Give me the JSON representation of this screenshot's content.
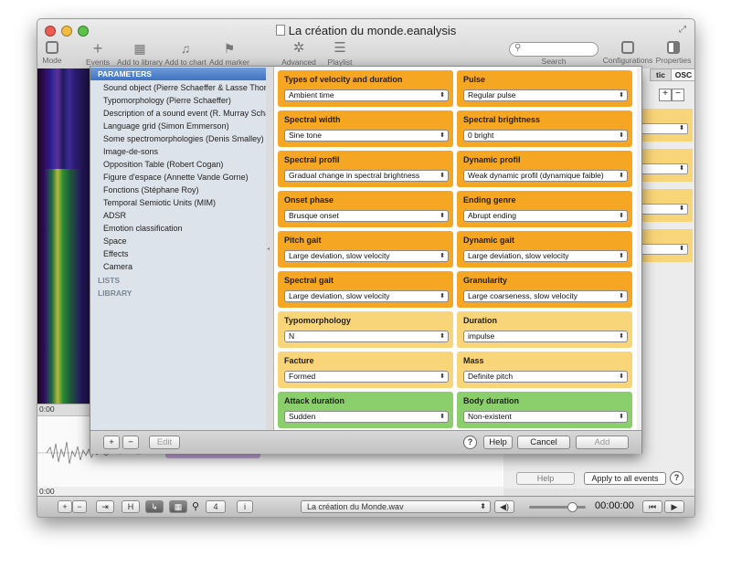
{
  "window": {
    "title": "La création du monde.eanalysis"
  },
  "toolbar": {
    "mode": "Mode",
    "events": "Events",
    "add_to_library": "Add to library",
    "add_to_chart": "Add to chart",
    "add_marker": "Add marker",
    "advanced_tools": "Advanced tools",
    "playlist": "Playlist",
    "search_label": "Search",
    "configurations": "Configurations",
    "properties": "Properties"
  },
  "right_panel": {
    "tab_partial": "tic",
    "tab_osc": "OSC",
    "help_button": "Help",
    "apply_all_button": "Apply to all events",
    "help_icon": "?"
  },
  "timeline": {
    "time_start_top": "0:00",
    "time_start_bottom": "0:00"
  },
  "bottom_bar": {
    "plus": "+",
    "minus": "−",
    "zoom_value": "4",
    "info": "i",
    "audio_file": "La création du Monde.wav",
    "time": "00:00:00"
  },
  "library": {
    "parameters_header": "PARAMETERS",
    "items": [
      "Sound object (Pierre Schaeffer & Lasse Thoresen)",
      "Typomorphology (Pierre Schaeffer)",
      "Description of a sound event (R. Murray Schafer)",
      "Language grid (Simon Emmerson)",
      "Some spectromorphologies (Denis Smalley)",
      "Image-de-sons",
      "Opposition Table (Robert Cogan)",
      "Figure d'espace (Annette Vande Gorne)",
      "Fonctions (Stéphane Roy)",
      "Temporal Semiotic Units (MIM)",
      "ADSR",
      "Emotion classification",
      "Space",
      "Effects",
      "Camera"
    ],
    "lists_header": "LISTS",
    "library_header": "LIBRARY"
  },
  "fields": [
    {
      "label": "Types of velocity and duration",
      "value": "Ambient time",
      "color": "#f5a623"
    },
    {
      "label": "Pulse",
      "value": "Regular pulse",
      "color": "#f5a623"
    },
    {
      "label": "Spectral width",
      "value": "Sine tone",
      "color": "#f5a623"
    },
    {
      "label": "Spectral brightness",
      "value": "0 bright",
      "color": "#f5a623"
    },
    {
      "label": "Spectral profil",
      "value": "Gradual change in spectral brightness",
      "color": "#f5a623"
    },
    {
      "label": "Dynamic profil",
      "value": "Weak dynamic profil (dynamique faible)",
      "color": "#f5a623"
    },
    {
      "label": "Onset phase",
      "value": "Brusque onset",
      "color": "#f5a623"
    },
    {
      "label": "Ending genre",
      "value": "Abrupt ending",
      "color": "#f5a623"
    },
    {
      "label": "Pitch gait",
      "value": "Large deviation, slow velocity",
      "color": "#f5a623"
    },
    {
      "label": "Dynamic gait",
      "value": "Large deviation, slow velocity",
      "color": "#f5a623"
    },
    {
      "label": "Spectral gait",
      "value": "Large deviation, slow velocity",
      "color": "#f5a623"
    },
    {
      "label": "Granularity",
      "value": "Large coarseness, slow velocity",
      "color": "#f5a623"
    },
    {
      "label": "Typomorphology",
      "value": "N",
      "color": "#f9d579"
    },
    {
      "label": "Duration",
      "value": "impulse",
      "color": "#f9d579"
    },
    {
      "label": "Facture",
      "value": "Formed",
      "color": "#f9d579"
    },
    {
      "label": "Mass",
      "value": "Definite pitch",
      "color": "#f9d579"
    },
    {
      "label": "Attack duration",
      "value": "Sudden",
      "color": "#8bcf6c"
    },
    {
      "label": "Body duration",
      "value": "Non-existent",
      "color": "#8bcf6c"
    }
  ],
  "sheet_bar": {
    "add": "+",
    "remove": "−",
    "edit": "Edit",
    "help_icon": "?",
    "help": "Help",
    "cancel": "Cancel",
    "add_button": "Add"
  }
}
